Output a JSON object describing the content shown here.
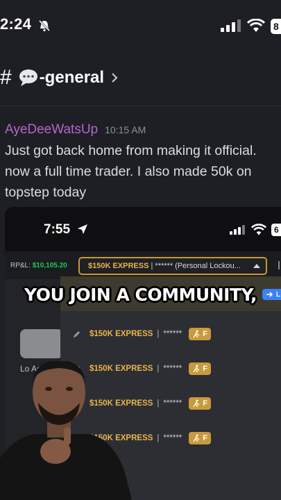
{
  "status_bar": {
    "time": "2:24",
    "battery": "8"
  },
  "channel": {
    "hash": "#",
    "name": "-general"
  },
  "message": {
    "author": "AyeDeeWatsUp",
    "timestamp": "10:15 AM",
    "text": "Just got back home from making it official. now a full time trader. I also made 50k on topstep today"
  },
  "screenshot": {
    "time": "7:55",
    "battery": "6",
    "rpl_label": "RP&L:",
    "rpl_value": "$10,105.20",
    "account_name": "$150K EXPRESS",
    "account_rest": "| ****** (Personal Lockou...",
    "left_label": "Lo     Ac",
    "selected_badge": "L",
    "rows": [
      {
        "name": "$150K EXPRESS",
        "sep": "|",
        "mask": "******",
        "badge": "F"
      },
      {
        "name": "$150K EXPRESS",
        "sep": "|",
        "mask": "******",
        "badge": "F"
      },
      {
        "name": "$150K EXPRESS",
        "sep": "|",
        "mask": "******",
        "badge": "F"
      },
      {
        "name": "$150K EXPRESS",
        "sep": "|",
        "mask": "******",
        "badge": "F"
      }
    ]
  },
  "caption": "YOU JOIN A COMMUNITY,",
  "colors": {
    "author": "#b666d2",
    "gold": "#e8b54a",
    "green": "#22c55e",
    "accent_border": "#c79a2e"
  }
}
